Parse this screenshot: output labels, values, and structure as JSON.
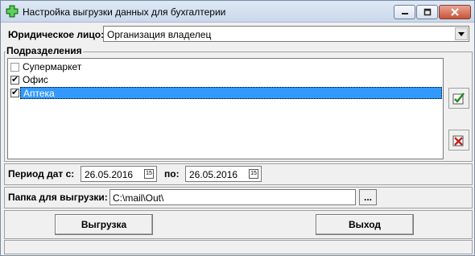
{
  "window": {
    "title": "Настройка выгрузки данных для бухгалтерии"
  },
  "entity": {
    "label": "Юридическое лицо:",
    "value": "Организация владелец"
  },
  "departments": {
    "title": "Подразделения",
    "items": [
      {
        "label": "Супермаркет",
        "checked": false,
        "selected": false
      },
      {
        "label": "Офис",
        "checked": true,
        "selected": false
      },
      {
        "label": "Аптека",
        "checked": true,
        "selected": true
      }
    ]
  },
  "period": {
    "label_from": "Период дат с:",
    "date_from": "26.05.2016",
    "label_to": "по:",
    "date_to": "26.05.2016"
  },
  "folder": {
    "label": "Папка для выгрузки:",
    "value": "C:\\mail\\Out\\",
    "browse_label": "..."
  },
  "actions": {
    "export_label": "Выгрузка",
    "exit_label": "Выход"
  },
  "icons": {
    "app": "green-cross-icon",
    "check_all": "check-all-icon",
    "uncheck_all": "uncheck-all-icon",
    "calendar": "calendar-icon"
  },
  "colors": {
    "selection": "#3399ff",
    "window_bg": "#f0f0f0"
  }
}
